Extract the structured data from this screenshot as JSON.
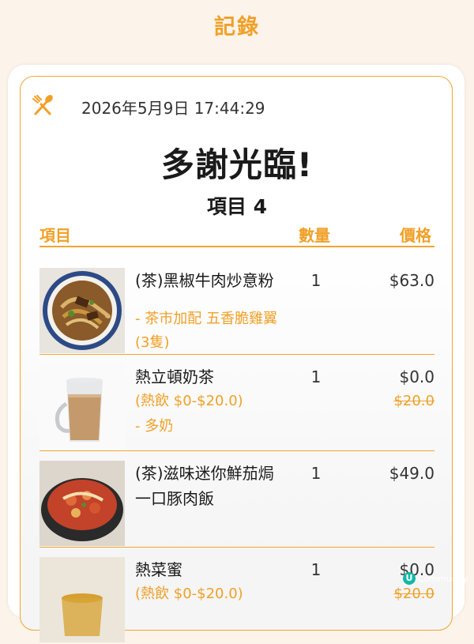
{
  "header": {
    "title": "記錄"
  },
  "receipt": {
    "datetime": "2026年5月9日 17:44:29",
    "thanks": "多謝光臨!",
    "item_count": "項目 4",
    "columns": {
      "item": "項目",
      "qty": "數量",
      "price": "價格"
    },
    "items": [
      {
        "name": "(茶)黑椒牛肉炒意粉",
        "options": [
          "- 茶市加配 五香脆雞翼(3隻)"
        ],
        "qty": "1",
        "price": "$63.0",
        "original_price": ""
      },
      {
        "name": "熱立頓奶茶",
        "price_range": "(熱飲 $0-$20.0)",
        "options": [
          "- 多奶"
        ],
        "qty": "1",
        "price": "$0.0",
        "original_price": "$20.0"
      },
      {
        "name": "(茶)滋味迷你鮮茄焗一口豚肉飯",
        "options": [],
        "qty": "1",
        "price": "$49.0",
        "original_price": ""
      },
      {
        "name": "熱菜蜜",
        "price_range": "(熱飲 $0-$20.0)",
        "options": [],
        "qty": "1",
        "price": "$0.0",
        "original_price": "$20.0"
      }
    ]
  },
  "watermark": {
    "text": "Community"
  },
  "colors": {
    "accent": "#f0a028",
    "background": "#fcf3ea",
    "watermark": "#14b8a6"
  },
  "icons": {
    "header": "fork-spoon-icon",
    "watermark": "u-logo-icon"
  }
}
